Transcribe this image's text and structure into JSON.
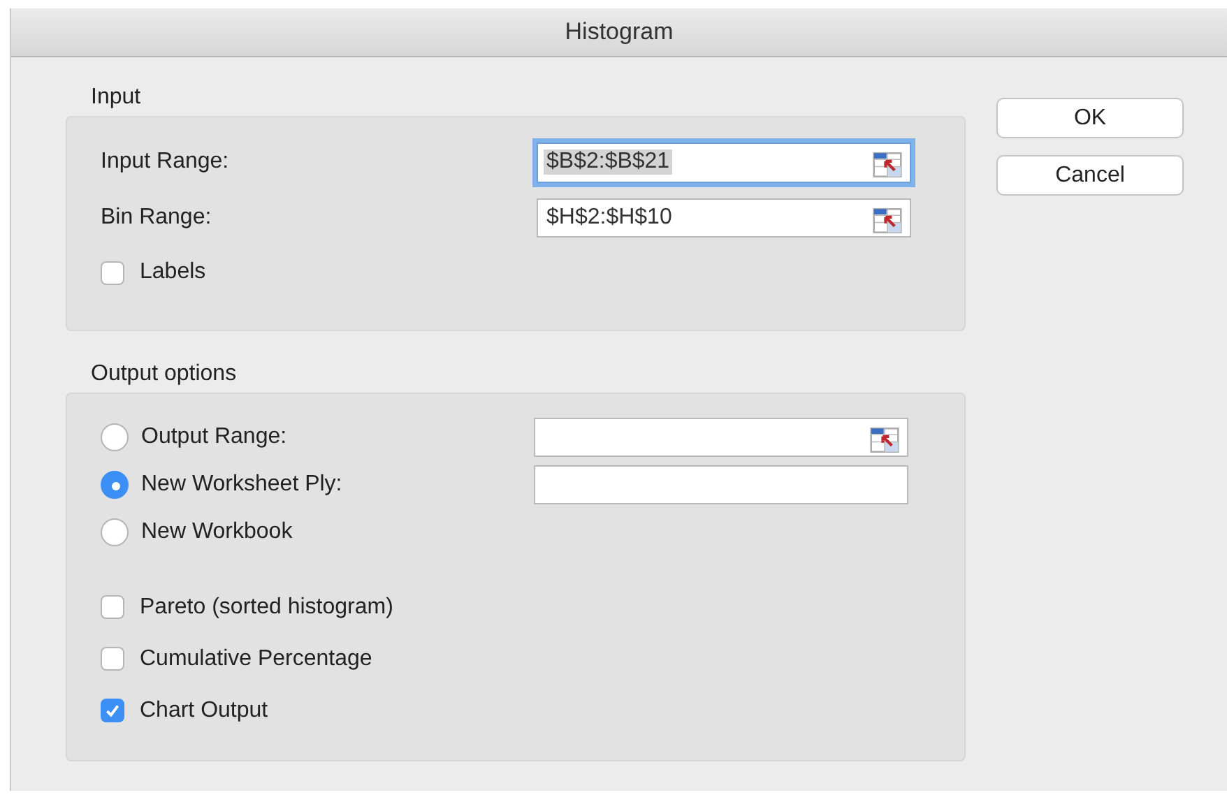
{
  "window": {
    "title": "Histogram"
  },
  "input": {
    "title": "Input",
    "fields": [
      {
        "label": "Input Range:",
        "value": "$B$2:$B$21",
        "focused": true,
        "picker": true
      },
      {
        "label": "Bin Range:",
        "value": "$H$2:$H$10",
        "focused": false,
        "picker": true
      }
    ],
    "checkboxes": [
      {
        "label": "Labels",
        "checked": false
      }
    ]
  },
  "output": {
    "title": "Output options",
    "options": [
      {
        "label": "Output Range:",
        "selected": false,
        "has_field": true,
        "picker": true
      },
      {
        "label": "New Worksheet Ply:",
        "selected": true,
        "has_field": true,
        "picker": false
      },
      {
        "label": "New Workbook",
        "selected": false,
        "has_field": false,
        "picker": false
      }
    ],
    "checkboxes": [
      {
        "label": "Pareto (sorted histogram)",
        "checked": false
      },
      {
        "label": "Cumulative Percentage",
        "checked": false
      },
      {
        "label": "Chart Output",
        "checked": true
      }
    ]
  },
  "buttons": [
    {
      "label": "OK"
    },
    {
      "label": "Cancel"
    }
  ]
}
